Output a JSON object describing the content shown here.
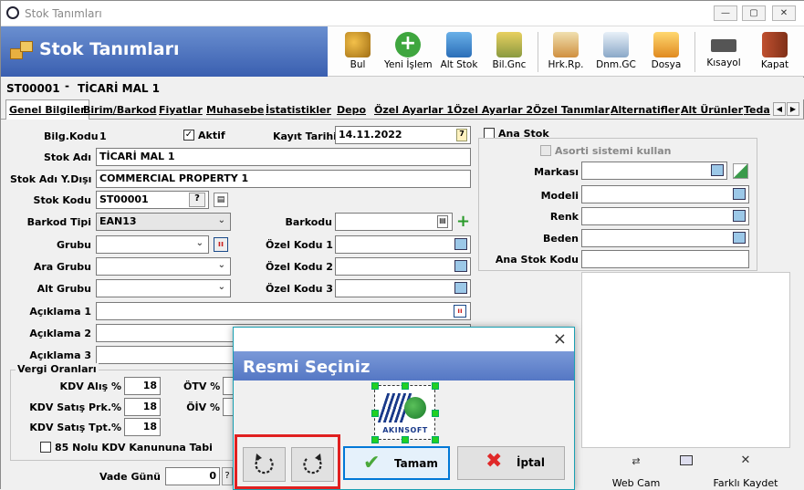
{
  "window": {
    "title": "Stok Tanımları"
  },
  "header": {
    "title": "Stok Tanımları"
  },
  "toolbar": [
    {
      "label": "Bul",
      "icon": "binoculars-icon"
    },
    {
      "label": "Yeni İşlem",
      "icon": "plus-circle-icon"
    },
    {
      "label": "Alt Stok",
      "icon": "network-icon"
    },
    {
      "label": "Bil.Gnc",
      "icon": "coins-icon"
    },
    {
      "label": "Hrk.Rp.",
      "icon": "report-icon"
    },
    {
      "label": "Dnm.GC",
      "icon": "document-clock-icon"
    },
    {
      "label": "Dosya",
      "icon": "folder-icon"
    },
    {
      "label": "Kısayol",
      "icon": "keyboard-icon"
    },
    {
      "label": "Kapat",
      "icon": "exit-door-icon"
    }
  ],
  "codebar": {
    "code": "ST00001",
    "sep": "-",
    "name": "TİCARİ MAL 1"
  },
  "tabs": [
    "Genel Bilgiler",
    "Birim/Barkod",
    "Fiyatlar",
    "Muhasebe",
    "İstatistikler",
    "Depo",
    "Özel Ayarlar 1",
    "Özel Ayarlar 2",
    "Özel Tanımlar",
    "Alternatifler",
    "Alt Ürünler",
    "Teda"
  ],
  "form": {
    "bilg_kodu_label": "Bilg.Kodu",
    "bilg_kodu": "1",
    "aktif_label": "Aktif",
    "kayit_tarihi_label": "Kayıt Tarihi",
    "kayit_tarihi": "14.11.2022",
    "stok_adi_label": "Stok Adı",
    "stok_adi": "TİCARİ MAL 1",
    "stok_adi_yd_label": "Stok Adı Y.Dışı",
    "stok_adi_yd": "COMMERCIAL PROPERTY 1",
    "stok_kodu_label": "Stok Kodu",
    "stok_kodu": "ST00001",
    "barkod_tipi_label": "Barkod Tipi",
    "barkod_tipi": "EAN13",
    "barkodu_label": "Barkodu",
    "grubu_label": "Grubu",
    "ara_grubu_label": "Ara Grubu",
    "alt_grubu_label": "Alt Grubu",
    "ozel1_label": "Özel Kodu 1",
    "ozel2_label": "Özel Kodu 2",
    "ozel3_label": "Özel Kodu 3",
    "aciklama1_label": "Açıklama 1",
    "aciklama2_label": "Açıklama 2",
    "aciklama3_label": "Açıklama 3",
    "vergi_label": "Vergi Oranları",
    "kdv_alis_label": "KDV Alış %",
    "kdv_alis": "18",
    "kdv_sprk_label": "KDV Satış Prk.%",
    "kdv_sprk": "18",
    "kdv_stpt_label": "KDV Satış Tpt.%",
    "kdv_stpt": "18",
    "otv_label": "ÖTV %",
    "oiv_label": "ÖİV %",
    "kanun_label": "85 Nolu KDV Kanununa Tabi",
    "vade_label": "Vade Günü",
    "vade": "0",
    "q_label": "?"
  },
  "right": {
    "ana_stok_label": "Ana Stok",
    "asorti_label": "Asorti sistemi kullan",
    "markasi_label": "Markası",
    "modeli_label": "Modeli",
    "renk_label": "Renk",
    "beden_label": "Beden",
    "ana_stok_kodu_label": "Ana Stok Kodu",
    "webcam_label": "Web Cam",
    "farkli_kaydet_label": "Farklı Kaydet"
  },
  "dialog": {
    "title": "Resmi Seçiniz",
    "close": "×",
    "ok_label": "Tamam",
    "cancel_label": "İptal",
    "logo_text": "AKINSOFT"
  },
  "colors": {
    "accent": "#1aa0b2",
    "banner": "#4a6fc0",
    "highlight": "#e02020"
  }
}
